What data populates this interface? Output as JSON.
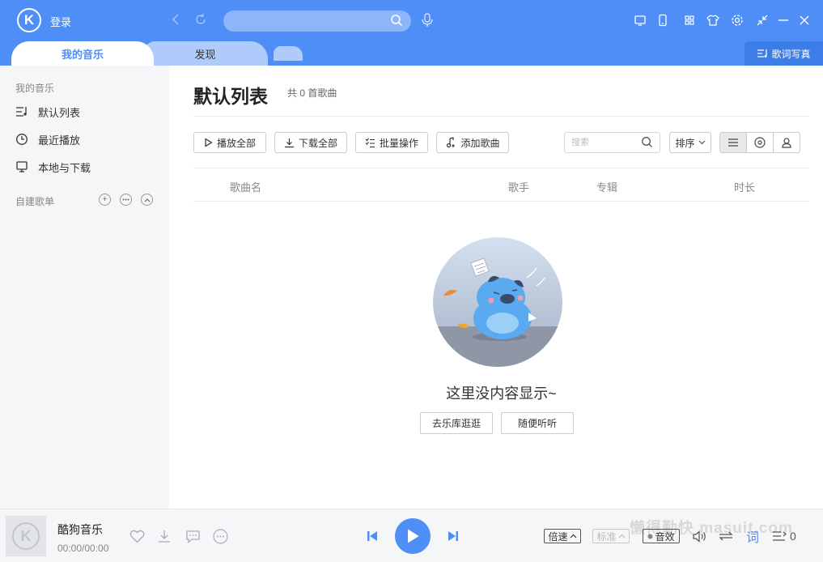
{
  "titlebar": {
    "logo_letter": "K",
    "login_label": "登录",
    "search_placeholder": "",
    "tabs": {
      "my_music": "我的音乐",
      "discover": "发现"
    },
    "lyric_photo_label": "歌词写真"
  },
  "sidebar": {
    "section_title": "我的音乐",
    "items": [
      {
        "label": "默认列表",
        "icon": "playlist-icon"
      },
      {
        "label": "最近播放",
        "icon": "clock-icon"
      },
      {
        "label": "本地与下载",
        "icon": "monitor-icon"
      }
    ],
    "custom_title": "自建歌单"
  },
  "main": {
    "title": "默认列表",
    "song_count": "共 0 首歌曲",
    "actions": {
      "play_all": "播放全部",
      "download_all": "下载全部",
      "batch": "批量操作",
      "add_song": "添加歌曲"
    },
    "filter_placeholder": "搜索",
    "sort_label": "排序",
    "columns": {
      "name": "歌曲名",
      "artist": "歌手",
      "album": "专辑",
      "duration": "时长"
    },
    "empty_text": "这里没内容显示~",
    "empty_buttons": {
      "browse": "去乐库逛逛",
      "random": "随便听听"
    }
  },
  "player": {
    "cover_letter": "K",
    "title": "酷狗音乐",
    "time": "00:00/00:00",
    "speed_label": "倍速",
    "quality_label": "标准",
    "effect_label": "音效",
    "lyric_label": "词",
    "queue_count": "0",
    "watermark": "懒得勤快 masuit.com"
  },
  "colors": {
    "accent": "#4f8ef7",
    "sidebar_bg": "#f5f6f8"
  }
}
